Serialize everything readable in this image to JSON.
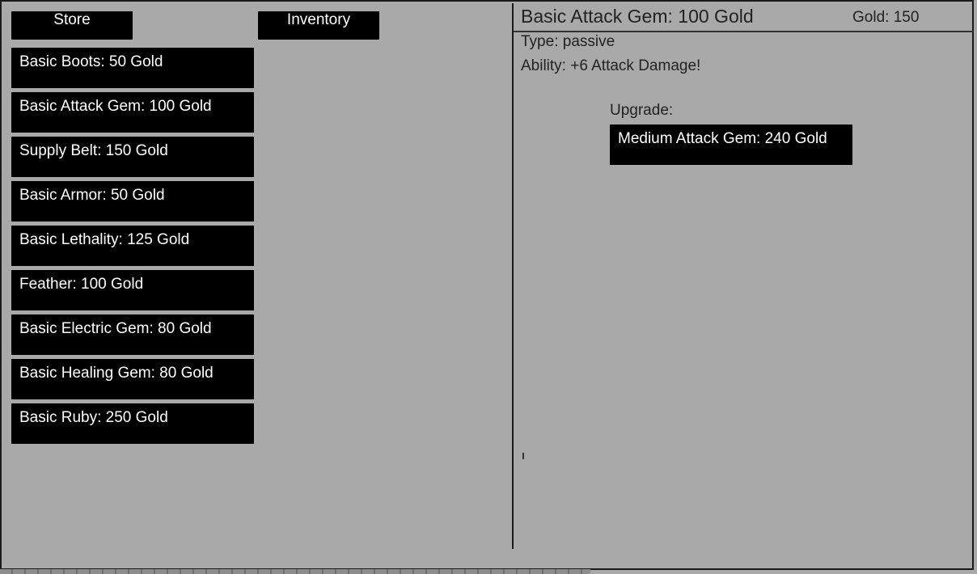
{
  "tabs": {
    "store_label": "Store",
    "inventory_label": "Inventory"
  },
  "store": {
    "items": [
      "Basic Boots: 50 Gold",
      "Basic Attack Gem: 100 Gold",
      "Supply Belt: 150 Gold",
      "Basic Armor: 50 Gold",
      "Basic Lethality: 125 Gold",
      "Feather: 100 Gold",
      "Basic Electric Gem: 80 Gold",
      "Basic Healing Gem: 80 Gold",
      "Basic Ruby: 250 Gold"
    ]
  },
  "details": {
    "title": "Basic Attack Gem: 100 Gold",
    "gold": "Gold: 150",
    "type": "Type: passive",
    "ability": "Ability: +6 Attack Damage!",
    "upgrade_label": "Upgrade:",
    "upgrade_item": "Medium Attack Gem: 240 Gold"
  }
}
